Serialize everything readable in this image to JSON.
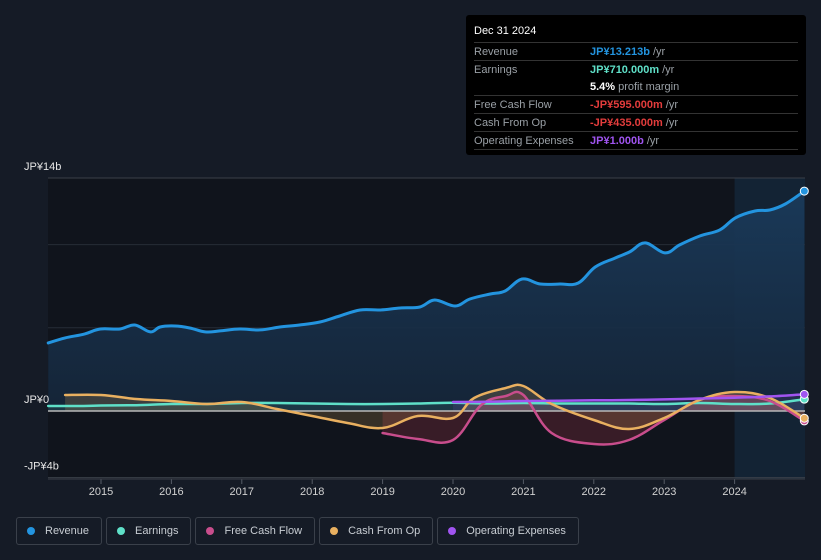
{
  "tooltip": {
    "date": "Dec 31 2024",
    "rows": [
      {
        "label": "Revenue",
        "value": "JP¥13.213b",
        "unit": "/yr",
        "color": "#2394df"
      },
      {
        "label": "Earnings",
        "value": "JP¥710.000m",
        "unit": "/yr",
        "color": "#5fe0c8"
      },
      {
        "label": "",
        "value": "5.4%",
        "unit": "profit margin",
        "color": "#ffffff"
      },
      {
        "label": "Free Cash Flow",
        "value": "-JP¥595.000m",
        "unit": "/yr",
        "color": "#e33c3c"
      },
      {
        "label": "Cash From Op",
        "value": "-JP¥435.000m",
        "unit": "/yr",
        "color": "#e33c3c"
      },
      {
        "label": "Operating Expenses",
        "value": "JP¥1.000b",
        "unit": "/yr",
        "color": "#a054f0"
      }
    ]
  },
  "legend": [
    {
      "label": "Revenue",
      "color": "#2394df"
    },
    {
      "label": "Earnings",
      "color": "#5fe0c8"
    },
    {
      "label": "Free Cash Flow",
      "color": "#c84d8c"
    },
    {
      "label": "Cash From Op",
      "color": "#e9b060"
    },
    {
      "label": "Operating Expenses",
      "color": "#a054f0"
    }
  ],
  "chart_data": {
    "type": "area",
    "title": "",
    "xlabel": "",
    "ylabel": "",
    "unit": "JP¥ billions",
    "ylim": [
      -4,
      14
    ],
    "xlim": [
      2014.25,
      2025.0
    ],
    "y_tick_labels": [
      {
        "value": 14,
        "label": "JP¥14b"
      },
      {
        "value": 0,
        "label": "JP¥0"
      },
      {
        "value": -4,
        "label": "-JP¥4b"
      }
    ],
    "gridlines": [
      14,
      10,
      5,
      0,
      -4
    ],
    "x_ticks": [
      2015,
      2016,
      2017,
      2018,
      2019,
      2020,
      2021,
      2022,
      2023,
      2024
    ],
    "x_tick_labels": [
      "2015",
      "2016",
      "2017",
      "2018",
      "2019",
      "2020",
      "2021",
      "2022",
      "2023",
      "2024"
    ],
    "highlight_from": 2024.0,
    "series": [
      {
        "name": "Revenue",
        "color": "#2394df",
        "x": [
          2014.25,
          2014.49,
          2014.77,
          2014.99,
          2015.27,
          2015.48,
          2015.7,
          2015.84,
          2016.05,
          2016.26,
          2016.48,
          2016.69,
          2016.97,
          2017.26,
          2017.54,
          2017.82,
          2018.11,
          2018.39,
          2018.68,
          2018.96,
          2019.25,
          2019.53,
          2019.74,
          2020.03,
          2020.24,
          2020.53,
          2020.74,
          2020.98,
          2021.24,
          2021.52,
          2021.78,
          2022.02,
          2022.3,
          2022.51,
          2022.73,
          2023.01,
          2023.22,
          2023.51,
          2023.79,
          2024.01,
          2024.29,
          2024.5,
          2024.72,
          2024.99
        ],
        "values": [
          4.09,
          4.39,
          4.63,
          4.93,
          4.93,
          5.17,
          4.75,
          5.05,
          5.11,
          4.99,
          4.75,
          4.81,
          4.93,
          4.87,
          5.05,
          5.17,
          5.35,
          5.71,
          6.07,
          6.07,
          6.19,
          6.25,
          6.67,
          6.31,
          6.73,
          7.03,
          7.21,
          7.93,
          7.63,
          7.63,
          7.69,
          8.65,
          9.19,
          9.56,
          10.1,
          9.5,
          9.98,
          10.52,
          10.88,
          11.6,
          12.02,
          12.08,
          12.44,
          13.213
        ]
      },
      {
        "name": "Earnings",
        "color": "#5fe0c8",
        "x": [
          2014.25,
          2014.75,
          2015.0,
          2015.5,
          2016.0,
          2016.5,
          2017.0,
          2017.5,
          2018.0,
          2018.5,
          2019.0,
          2019.5,
          2020.0,
          2020.5,
          2021.0,
          2021.5,
          2022.0,
          2022.5,
          2023.0,
          2023.5,
          2024.0,
          2024.5,
          2024.99
        ],
        "values": [
          0.3,
          0.3,
          0.33,
          0.35,
          0.42,
          0.42,
          0.48,
          0.48,
          0.45,
          0.42,
          0.42,
          0.45,
          0.5,
          0.45,
          0.48,
          0.45,
          0.45,
          0.45,
          0.42,
          0.48,
          0.42,
          0.45,
          0.71
        ]
      },
      {
        "name": "Free Cash Flow",
        "color": "#c84d8c",
        "x": [
          2019.0,
          2019.5,
          2020.0,
          2020.4,
          2020.75,
          2021.0,
          2021.4,
          2022.0,
          2022.5,
          2023.0,
          2023.5,
          2024.0,
          2024.5,
          2024.99
        ],
        "values": [
          -1.32,
          -1.68,
          -1.74,
          0.36,
          0.9,
          0.96,
          -1.32,
          -1.98,
          -1.74,
          -0.54,
          0.66,
          0.9,
          0.6,
          -0.595
        ]
      },
      {
        "name": "Cash From Op",
        "color": "#e9b060",
        "x": [
          2014.49,
          2015.0,
          2015.5,
          2016.0,
          2016.5,
          2017.0,
          2017.5,
          2018.0,
          2018.5,
          2019.0,
          2019.5,
          2020.0,
          2020.3,
          2020.75,
          2021.0,
          2021.4,
          2022.0,
          2022.5,
          2023.0,
          2023.5,
          2024.0,
          2024.5,
          2024.99
        ],
        "values": [
          0.96,
          0.96,
          0.72,
          0.6,
          0.42,
          0.54,
          0.12,
          -0.3,
          -0.72,
          -1.02,
          -0.3,
          -0.42,
          0.78,
          1.38,
          1.5,
          0.42,
          -0.54,
          -1.08,
          -0.42,
          0.66,
          1.14,
          0.78,
          -0.435
        ]
      },
      {
        "name": "Operating Expenses",
        "color": "#a054f0",
        "x": [
          2020.0,
          2020.5,
          2021.0,
          2021.5,
          2022.0,
          2022.5,
          2023.0,
          2023.5,
          2024.0,
          2024.5,
          2024.99
        ],
        "values": [
          0.54,
          0.56,
          0.6,
          0.62,
          0.64,
          0.66,
          0.7,
          0.75,
          0.8,
          0.88,
          1.0
        ]
      }
    ]
  }
}
